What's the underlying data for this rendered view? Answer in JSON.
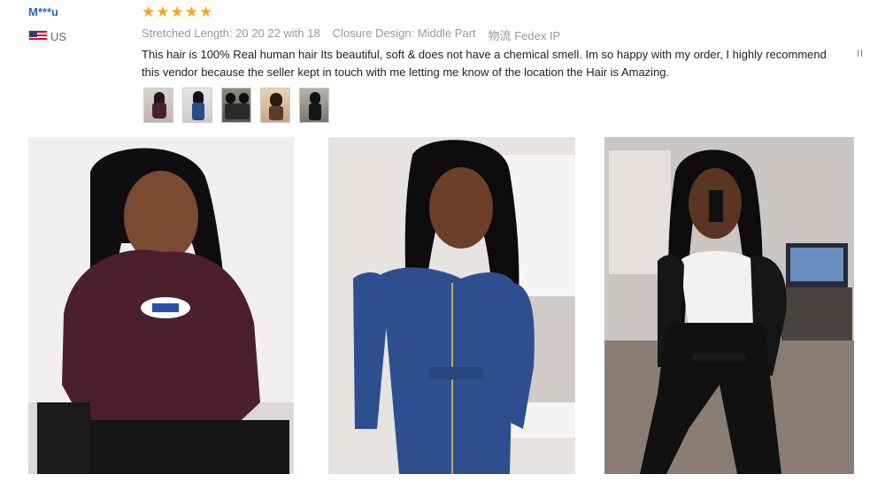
{
  "reviewer": {
    "name": "M***u",
    "country": "US",
    "flag_icon": "us-flag-icon"
  },
  "rating": {
    "stars": 5,
    "max": 5,
    "color": "#f5a623"
  },
  "attributes": [
    {
      "key": "Stretched Length:",
      "value": "20 20 22 with 18"
    },
    {
      "key": "Closure Design:",
      "value": "Middle Part"
    },
    {
      "key": "物流",
      "value": "Fedex IP"
    }
  ],
  "review_text": "This hair is 100% Real human hair Its beautiful, soft & does not have a chemical smell. Im so happy with my order, I highly recommend this vendor because the seller kept in touch with me letting me know of the location the Hair is Amazing.",
  "pause_icon": "pause-icon",
  "thumbnails": [
    "photo-thumbnail-1",
    "photo-thumbnail-2",
    "photo-thumbnail-3",
    "photo-thumbnail-4",
    "photo-thumbnail-5"
  ],
  "photos": [
    "review-photo-1",
    "review-photo-2",
    "review-photo-3"
  ]
}
